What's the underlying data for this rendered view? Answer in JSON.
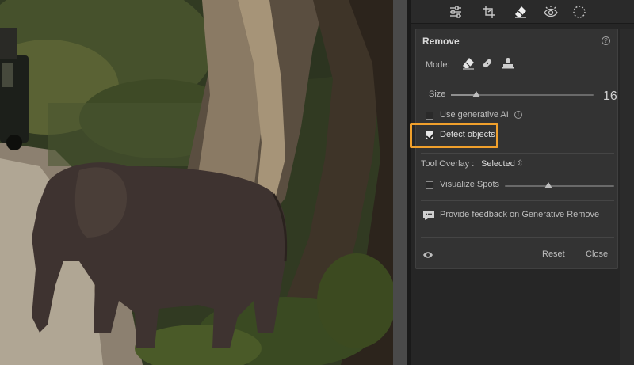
{
  "panel": {
    "title": "Remove",
    "help": "?",
    "mode_label": "Mode:",
    "mode_icons": [
      "eraser-icon",
      "bandage-icon",
      "stamp-icon"
    ],
    "size_label": "Size",
    "size_value": "16",
    "size_fraction": 0.18,
    "generative_ai_label": "Use generative AI",
    "generative_ai_checked": false,
    "detect_objects_label": "Detect objects",
    "detect_objects_checked": true,
    "tool_overlay_label": "Tool Overlay :",
    "tool_overlay_value": "Selected",
    "visualize_spots_label": "Visualize Spots",
    "visualize_spots_checked": false,
    "visualize_fraction": 0.4,
    "feedback_text": "Provide feedback on Generative Remove",
    "reset_label": "Reset",
    "close_label": "Close",
    "info": "!"
  },
  "toolstrip": {
    "tools": [
      "sliders-icon",
      "crop-icon",
      "eraser-icon",
      "redeye-icon",
      "mask-icon"
    ],
    "active": "eraser-icon"
  },
  "colors": {
    "highlight": "#f0a02c",
    "panel_bg": "#333333"
  }
}
